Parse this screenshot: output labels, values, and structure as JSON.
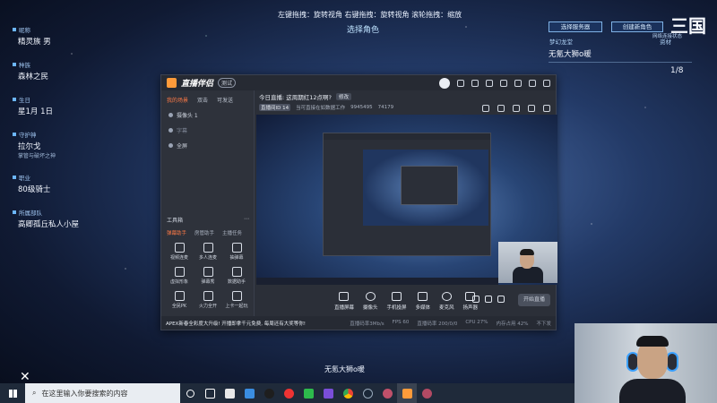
{
  "overlay": {
    "top_hint": "左键拖拽：旋转视角 右键拖拽：旋转视角 滚轮拖拽：缩放",
    "top_sub": "选择角色",
    "bottom_name": "无氪大狮o暖"
  },
  "character": {
    "fields": [
      {
        "label": "昵称",
        "value": "精灵族 男"
      },
      {
        "label": "种族",
        "value": "森林之民"
      },
      {
        "label": "生日",
        "value": "星1月 1日"
      },
      {
        "label": "守护神",
        "value": "拉尔戈",
        "sub": "掌管与破坏之神"
      },
      {
        "label": "职业",
        "value": "80级骑士"
      },
      {
        "label": "所属部队",
        "value": "高卿孤丘私人小屋"
      }
    ]
  },
  "right_panel": {
    "btn_left": "选择服务器",
    "btn_right": "创建新角色",
    "logo": "三国",
    "small": "网络连接状态",
    "label": "梦幻龙堂",
    "label2": "资材",
    "name": "无氪大狮o暖",
    "page": "1/8"
  },
  "app": {
    "name": "直播伴侣",
    "version": "测试",
    "left_tabs": [
      "我的场景",
      "双击",
      "可发送"
    ],
    "scenes": [
      {
        "label": "摄像头 1",
        "dim": false
      },
      {
        "label": "字幕",
        "dim": true
      },
      {
        "label": "全屏",
        "dim": false
      }
    ],
    "tools_title": "工具箱",
    "tool_tabs": [
      "弹幕助手",
      "房管助手",
      "主播任务"
    ],
    "tools": [
      "视频连麦",
      "多人连麦",
      "抽弹幕",
      "虚拟形象",
      "弹幕秀",
      "数据助手",
      "全民PK",
      "火力全开",
      "上卡一起玩"
    ],
    "stream_title": "今日直播: 这周期红12点啊?",
    "stream_btn": "修改",
    "info_tag": "直播间ID 14",
    "info_text": "当可直接在如数据工作",
    "info_fans": "9945495",
    "info_hot": "74179",
    "controls": [
      "直播屏幕",
      "摄像头",
      "手机投屏",
      "多媒体",
      "麦克风",
      "扬声器"
    ],
    "start_live": "开始直播",
    "notice": "APEX新春全彩度大升级! 开播即拿千元免费, 每周还有大奖等你!",
    "stats": [
      "直播码率3Mb/s",
      "FPS 60",
      "直播码率 200/0/0",
      "CPU 27%",
      "内存占用 42%"
    ],
    "status_right": "不下发"
  },
  "taskbar": {
    "search_placeholder": "在这里输入你要搜索的内容"
  }
}
